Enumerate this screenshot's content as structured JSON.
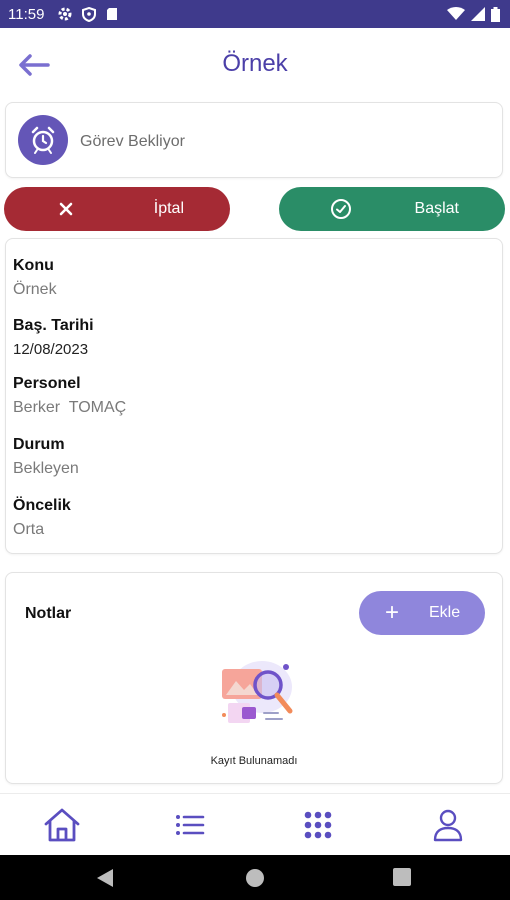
{
  "status_bar": {
    "time": "11:59"
  },
  "header": {
    "title": "Örnek"
  },
  "status_card": {
    "text": "Görev Bekliyor"
  },
  "actions": {
    "cancel_label": "İptal",
    "start_label": "Başlat"
  },
  "details": [
    {
      "label": "Konu",
      "value": "Örnek"
    },
    {
      "label": "Baş. Tarihi",
      "value": "12/08/2023"
    },
    {
      "label": "Personel",
      "value": "Berker  TOMAÇ"
    },
    {
      "label": "Durum",
      "value": "Bekleyen"
    },
    {
      "label": "Öncelik",
      "value": "Orta"
    }
  ],
  "notes": {
    "title": "Notlar",
    "add_label": "Ekle",
    "empty_text": "Kayıt Bulunamadı"
  },
  "colors": {
    "primary": "#4b3fa8",
    "status_bar": "#3f3a8c",
    "cancel": "#a52a34",
    "start": "#2a8d67",
    "add": "#8f86dc"
  },
  "icons": {
    "status_bar": [
      "settings-icon",
      "shield-icon",
      "sim-card-icon",
      "wifi-icon",
      "signal-icon",
      "battery-icon"
    ],
    "nav": [
      "home-icon",
      "list-icon",
      "grid-icon",
      "profile-icon"
    ],
    "system": [
      "back-triangle-icon",
      "home-circle-icon",
      "recents-square-icon"
    ]
  }
}
